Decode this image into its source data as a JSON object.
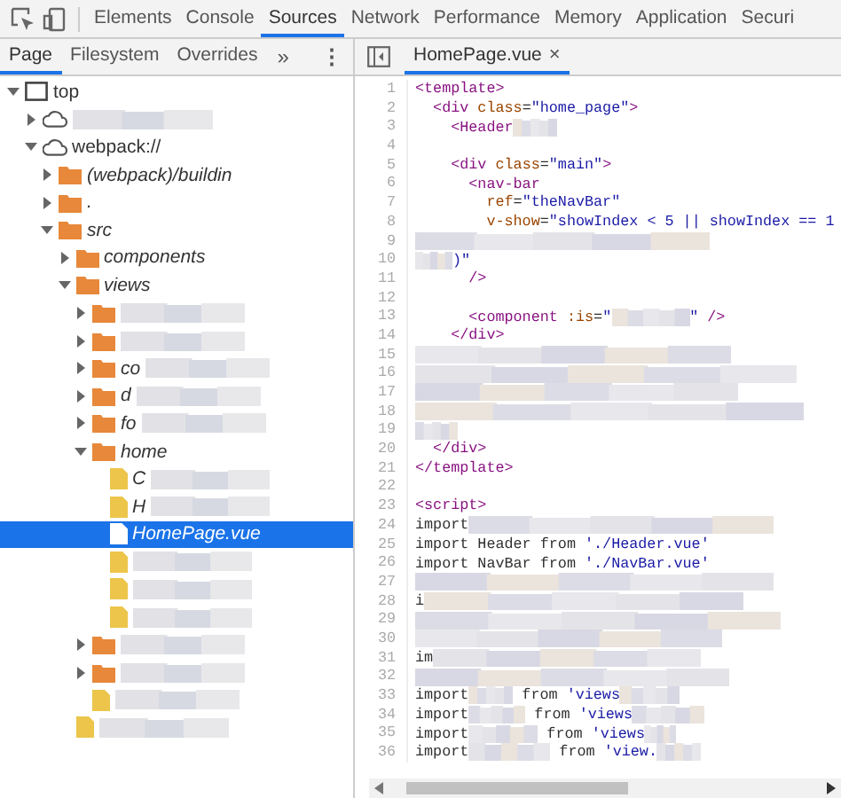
{
  "toolbar": {
    "tabs": [
      {
        "label": "Elements",
        "selected": false
      },
      {
        "label": "Console",
        "selected": false
      },
      {
        "label": "Sources",
        "selected": true
      },
      {
        "label": "Network",
        "selected": false
      },
      {
        "label": "Performance",
        "selected": false
      },
      {
        "label": "Memory",
        "selected": false
      },
      {
        "label": "Application",
        "selected": false
      },
      {
        "label": "Securi",
        "selected": false
      }
    ]
  },
  "navigator": {
    "tabs": [
      {
        "label": "Page",
        "selected": true
      },
      {
        "label": "Filesystem",
        "selected": false
      },
      {
        "label": "Overrides",
        "selected": false
      }
    ],
    "more": "»",
    "menu": "⋮",
    "tree": [
      {
        "name": "top",
        "kind": "frame",
        "expanded": true,
        "selected": false,
        "children": [
          {
            "kind": "cloud",
            "expanded": false,
            "selected": false,
            "redacted": true
          },
          {
            "name": "webpack://",
            "kind": "cloud",
            "expanded": true,
            "selected": false,
            "children": [
              {
                "name": "(webpack)/buildin",
                "kind": "folder",
                "expanded": false,
                "selected": false
              },
              {
                "name": ".",
                "kind": "folder",
                "expanded": false,
                "selected": false
              },
              {
                "name": "src",
                "kind": "folder",
                "expanded": true,
                "selected": false,
                "children": [
                  {
                    "name": "components",
                    "kind": "folder",
                    "expanded": false,
                    "selected": false
                  },
                  {
                    "name": "views",
                    "kind": "folder",
                    "expanded": true,
                    "selected": false,
                    "children": [
                      {
                        "kind": "folder",
                        "expanded": false,
                        "selected": false,
                        "redacted": true
                      },
                      {
                        "kind": "folder",
                        "expanded": false,
                        "selected": false,
                        "redacted": true
                      },
                      {
                        "name": "co",
                        "kind": "folder",
                        "expanded": false,
                        "selected": false,
                        "redacted": true
                      },
                      {
                        "name": "d",
                        "kind": "folder",
                        "expanded": false,
                        "selected": false,
                        "redacted": true
                      },
                      {
                        "name": "fo",
                        "kind": "folder",
                        "expanded": false,
                        "selected": false,
                        "redacted": true
                      },
                      {
                        "name": "home",
                        "kind": "folder",
                        "expanded": true,
                        "selected": false,
                        "children": [
                          {
                            "name": "C",
                            "kind": "script",
                            "selected": false,
                            "redacted": true
                          },
                          {
                            "name": "H",
                            "kind": "script",
                            "selected": false,
                            "redacted": true
                          },
                          {
                            "name": "HomePage.vue",
                            "kind": "document",
                            "selected": true
                          },
                          {
                            "kind": "script",
                            "selected": false,
                            "redacted": true
                          },
                          {
                            "kind": "script",
                            "selected": false,
                            "redacted": true
                          },
                          {
                            "kind": "script",
                            "selected": false,
                            "redacted": true
                          }
                        ]
                      },
                      {
                        "kind": "folder",
                        "expanded": false,
                        "selected": false,
                        "redacted": true
                      },
                      {
                        "kind": "folder",
                        "expanded": false,
                        "selected": false,
                        "redacted": true
                      },
                      {
                        "kind": "script",
                        "selected": false,
                        "redacted": true
                      }
                    ]
                  },
                  {
                    "kind": "script",
                    "selected": false,
                    "redacted": true
                  }
                ]
              }
            ]
          }
        ]
      }
    ]
  },
  "editor": {
    "tabs": [
      {
        "label": "HomePage.vue",
        "close": "×",
        "selected": true
      }
    ],
    "lines": [
      {
        "number": "1",
        "tokens": [
          {
            "kind": "tag",
            "text": "<template>"
          }
        ]
      },
      {
        "number": "2",
        "tokens": [
          {
            "kind": "tag",
            "text": "  <div"
          },
          {
            "kind": "attr",
            "text": " class"
          },
          {
            "kind": "plain",
            "text": "="
          },
          {
            "kind": "string",
            "text": "\"home_page\""
          },
          {
            "kind": "tag",
            "text": ">"
          }
        ]
      },
      {
        "number": "3",
        "tokens": [
          {
            "kind": "tag",
            "text": "    <Header"
          },
          {
            "kind": "redacted"
          }
        ]
      },
      {
        "number": "4"
      },
      {
        "number": "5",
        "tokens": [
          {
            "kind": "tag",
            "text": "    <div"
          },
          {
            "kind": "attr",
            "text": " class"
          },
          {
            "kind": "plain",
            "text": "="
          },
          {
            "kind": "string",
            "text": "\"main\""
          },
          {
            "kind": "tag",
            "text": ">"
          }
        ]
      },
      {
        "number": "6",
        "tokens": [
          {
            "kind": "tag",
            "text": "      <nav-bar"
          }
        ]
      },
      {
        "number": "7",
        "tokens": [
          {
            "kind": "attr",
            "text": "        ref"
          },
          {
            "kind": "plain",
            "text": "="
          },
          {
            "kind": "string",
            "text": "\"theNavBar\""
          }
        ]
      },
      {
        "number": "8",
        "tokens": [
          {
            "kind": "attr",
            "text": "        v-show"
          },
          {
            "kind": "plain",
            "text": "="
          },
          {
            "kind": "string",
            "text": "\"showIndex < 5 || showIndex == 1"
          }
        ]
      },
      {
        "number": "9",
        "tokens": [
          {
            "kind": "redacted-line"
          }
        ]
      },
      {
        "number": "10",
        "tokens": [
          {
            "kind": "redacted"
          },
          {
            "kind": "string",
            "text": ")\""
          }
        ]
      },
      {
        "number": "11",
        "tokens": [
          {
            "kind": "tag",
            "text": "      />"
          }
        ]
      },
      {
        "number": "12"
      },
      {
        "number": "13",
        "tokens": [
          {
            "kind": "tag",
            "text": "      <component"
          },
          {
            "kind": "attr",
            "text": " :is"
          },
          {
            "kind": "plain",
            "text": "="
          },
          {
            "kind": "string",
            "text": "\""
          },
          {
            "kind": "redacted"
          },
          {
            "kind": "string",
            "text": "\""
          },
          {
            "kind": "tag",
            "text": " />"
          }
        ]
      },
      {
        "number": "14",
        "tokens": [
          {
            "kind": "tag",
            "text": "    </div>"
          }
        ]
      },
      {
        "number": "15",
        "tokens": [
          {
            "kind": "redacted-line"
          }
        ]
      },
      {
        "number": "16",
        "tokens": [
          {
            "kind": "redacted-line"
          }
        ]
      },
      {
        "number": "17",
        "tokens": [
          {
            "kind": "redacted-line"
          }
        ]
      },
      {
        "number": "18",
        "tokens": [
          {
            "kind": "redacted-line"
          }
        ]
      },
      {
        "number": "19",
        "tokens": [
          {
            "kind": "redacted"
          }
        ]
      },
      {
        "number": "20",
        "tokens": [
          {
            "kind": "tag",
            "text": "  </div>"
          }
        ]
      },
      {
        "number": "21",
        "tokens": [
          {
            "kind": "tag",
            "text": "</template>"
          }
        ]
      },
      {
        "number": "22"
      },
      {
        "number": "23",
        "tokens": [
          {
            "kind": "tag",
            "text": "<script>"
          }
        ]
      },
      {
        "number": "24",
        "tokens": [
          {
            "kind": "plain",
            "text": "import"
          },
          {
            "kind": "redacted-line"
          }
        ]
      },
      {
        "number": "25",
        "tokens": [
          {
            "kind": "plain",
            "text": "import Header from "
          },
          {
            "kind": "string",
            "text": "'./Header.vue'"
          }
        ]
      },
      {
        "number": "26",
        "tokens": [
          {
            "kind": "plain",
            "text": "import NavBar from "
          },
          {
            "kind": "string",
            "text": "'./NavBar.vue'"
          }
        ]
      },
      {
        "number": "27",
        "tokens": [
          {
            "kind": "redacted-line"
          }
        ]
      },
      {
        "number": "28",
        "tokens": [
          {
            "kind": "plain",
            "text": "i"
          },
          {
            "kind": "redacted-line"
          }
        ]
      },
      {
        "number": "29",
        "tokens": [
          {
            "kind": "redacted-line"
          }
        ]
      },
      {
        "number": "30",
        "tokens": [
          {
            "kind": "redacted-line"
          }
        ]
      },
      {
        "number": "31",
        "tokens": [
          {
            "kind": "plain",
            "text": "im"
          },
          {
            "kind": "redacted-line"
          }
        ]
      },
      {
        "number": "32",
        "tokens": [
          {
            "kind": "redacted-line"
          }
        ]
      },
      {
        "number": "33",
        "tokens": [
          {
            "kind": "plain",
            "text": "import"
          },
          {
            "kind": "redacted"
          },
          {
            "kind": "plain",
            "text": " from "
          },
          {
            "kind": "string",
            "text": "'views"
          },
          {
            "kind": "redacted"
          }
        ]
      },
      {
        "number": "34",
        "tokens": [
          {
            "kind": "plain",
            "text": "import"
          },
          {
            "kind": "redacted"
          },
          {
            "kind": "plain",
            "text": " from "
          },
          {
            "kind": "string",
            "text": "'views"
          },
          {
            "kind": "redacted"
          }
        ]
      },
      {
        "number": "35",
        "tokens": [
          {
            "kind": "plain",
            "text": "import"
          },
          {
            "kind": "redacted"
          },
          {
            "kind": "plain",
            "text": " from "
          },
          {
            "kind": "string",
            "text": "'views"
          },
          {
            "kind": "redacted"
          }
        ]
      },
      {
        "number": "36",
        "tokens": [
          {
            "kind": "plain",
            "text": "import"
          },
          {
            "kind": "redacted"
          },
          {
            "kind": "plain",
            "text": " from "
          },
          {
            "kind": "string",
            "text": "'view."
          },
          {
            "kind": "redacted"
          }
        ]
      }
    ]
  }
}
